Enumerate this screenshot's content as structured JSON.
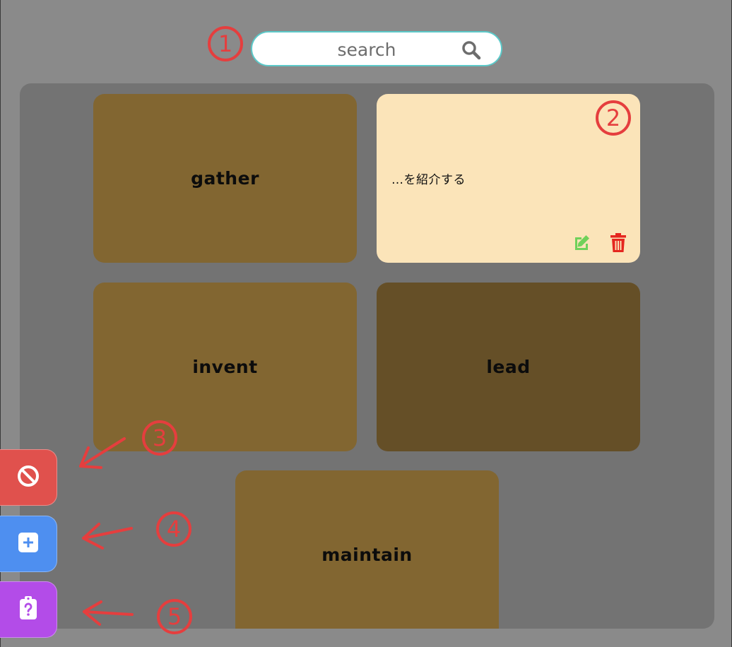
{
  "search": {
    "placeholder": "search",
    "value": ""
  },
  "cards": [
    {
      "word": "gather",
      "state": "front"
    },
    {
      "meaning": "…を紹介する",
      "state": "back"
    },
    {
      "word": "invent",
      "state": "front"
    },
    {
      "word": "lead",
      "state": "front-dimmed"
    },
    {
      "word": "maintain",
      "state": "front"
    }
  ],
  "annotations": [
    "1",
    "2",
    "3",
    "4",
    "5"
  ],
  "colors": {
    "background": "#8a8a8a",
    "panel": "#737373",
    "card": "#826631",
    "card_dark": "#654f27",
    "card_flipped": "#fbe4b9",
    "search_border": "#5cc9c9",
    "edit": "#6fd15a",
    "delete": "#e5261f",
    "block_button": "#e0514d",
    "add_button": "#4e8ff0",
    "quiz_button": "#b34ce8",
    "annotation": "#e53e3e"
  },
  "icons": [
    "search-icon",
    "edit-icon",
    "trash-icon",
    "block-icon",
    "plus-icon",
    "clipboard-question-icon"
  ]
}
